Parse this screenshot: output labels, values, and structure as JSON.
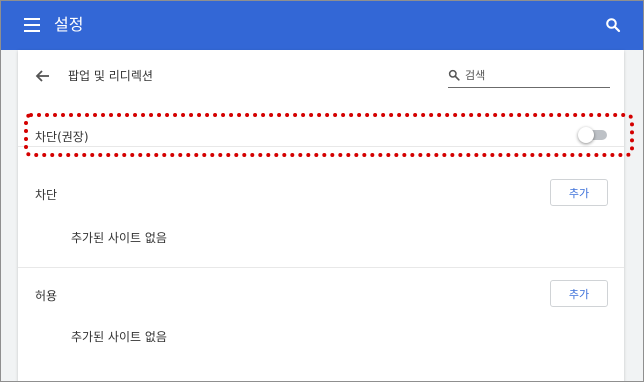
{
  "header": {
    "title": "설정"
  },
  "subpage": {
    "title": "팝업 및 리디렉션"
  },
  "search": {
    "placeholder": "검색",
    "value": ""
  },
  "blocked_recommended": {
    "label": "차단(권장)",
    "enabled": false
  },
  "block_section": {
    "label": "차단",
    "add_button_label": "추가",
    "empty_text": "추가된 사이트 없음"
  },
  "allow_section": {
    "label": "허용",
    "add_button_label": "추가",
    "empty_text": "추가된 사이트 없음"
  },
  "colors": {
    "header": "#3367d6",
    "accent": "#3b6fd9",
    "highlight": "#d40000",
    "toggle_off_track": "#bdc1c6"
  }
}
